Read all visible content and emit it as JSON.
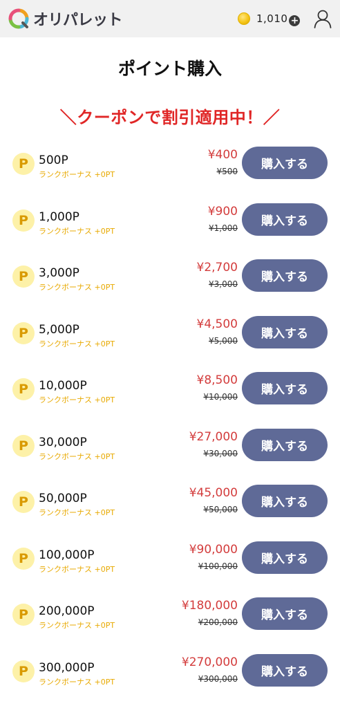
{
  "header": {
    "app_name": "オリパレット",
    "coin_balance": "1,010",
    "add_symbol": "+"
  },
  "page_title": "ポイント購入",
  "coupon_banner": "＼クーポンで割引適用中！／",
  "currency_icon_letter": "P",
  "items": [
    {
      "points": "500P",
      "bonus": "ランクボーナス +0PT",
      "price": "¥400",
      "original_price": "¥500",
      "button": "購入する"
    },
    {
      "points": "1,000P",
      "bonus": "ランクボーナス +0PT",
      "price": "¥900",
      "original_price": "¥1,000",
      "button": "購入する"
    },
    {
      "points": "3,000P",
      "bonus": "ランクボーナス +0PT",
      "price": "¥2,700",
      "original_price": "¥3,000",
      "button": "購入する"
    },
    {
      "points": "5,000P",
      "bonus": "ランクボーナス +0PT",
      "price": "¥4,500",
      "original_price": "¥5,000",
      "button": "購入する"
    },
    {
      "points": "10,000P",
      "bonus": "ランクボーナス +0PT",
      "price": "¥8,500",
      "original_price": "¥10,000",
      "button": "購入する"
    },
    {
      "points": "30,000P",
      "bonus": "ランクボーナス +0PT",
      "price": "¥27,000",
      "original_price": "¥30,000",
      "button": "購入する"
    },
    {
      "points": "50,000P",
      "bonus": "ランクボーナス +0PT",
      "price": "¥45,000",
      "original_price": "¥50,000",
      "button": "購入する"
    },
    {
      "points": "100,000P",
      "bonus": "ランクボーナス +0PT",
      "price": "¥90,000",
      "original_price": "¥100,000",
      "button": "購入する"
    },
    {
      "points": "200,000P",
      "bonus": "ランクボーナス +0PT",
      "price": "¥180,000",
      "original_price": "¥200,000",
      "button": "購入する"
    },
    {
      "points": "300,000P",
      "bonus": "ランクボーナス +0PT",
      "price": "¥270,000",
      "original_price": "¥300,000",
      "button": "購入する"
    }
  ],
  "colors": {
    "accent_red": "#e02626",
    "button_bg": "#5f6a97",
    "bonus_text": "#e8a900",
    "p_icon_bg": "#fdf1a8",
    "header_bg": "#f1f1f1"
  },
  "icons": {
    "logo": "palette-logo-icon",
    "coin": "coin-icon",
    "add": "plus-icon",
    "user": "user-icon",
    "point": "point-p-icon"
  }
}
